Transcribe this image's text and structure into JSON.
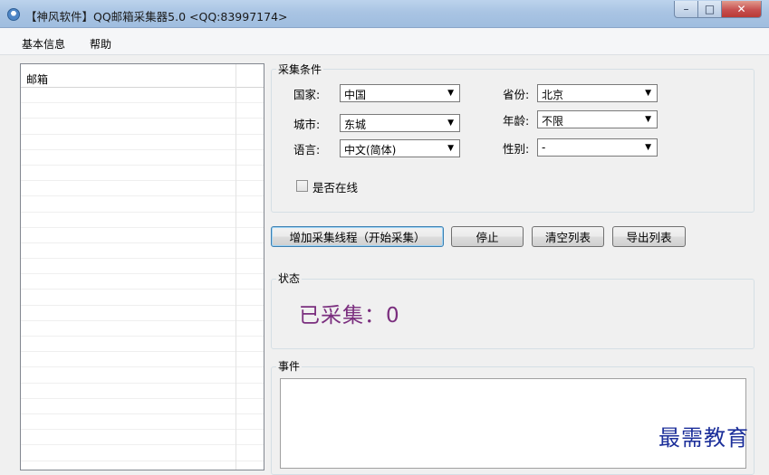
{
  "window": {
    "title": "【神风软件】QQ邮箱采集器5.0 <QQ:83997174>",
    "controls": {
      "minimize": "–",
      "maximize": "□",
      "close": "✕"
    }
  },
  "menu": {
    "items": [
      {
        "label": "基本信息"
      },
      {
        "label": "帮助"
      }
    ]
  },
  "email_list": {
    "header": "邮箱"
  },
  "criteria": {
    "title": "采集条件",
    "country_label": "国家:",
    "country_value": "中国",
    "city_label": "城市:",
    "city_value": "东城",
    "language_label": "语言:",
    "language_value": "中文(简体)",
    "province_label": "省份:",
    "province_value": "北京",
    "age_label": "年龄:",
    "age_value": "不限",
    "gender_label": "性别:",
    "gender_value": "-",
    "online_label": "是否在线",
    "online_checked": false
  },
  "buttons": {
    "start": "增加采集线程（开始采集）",
    "stop": "停止",
    "clear": "清空列表",
    "export": "导出列表"
  },
  "status": {
    "title": "状态",
    "collected": "已采集：0"
  },
  "events": {
    "title": "事件"
  },
  "watermark": "最需教育",
  "colors": {
    "collected_text": "#7a2e7e",
    "watermark": "#1c2f9a",
    "titlebar": "#a9c4e3"
  }
}
